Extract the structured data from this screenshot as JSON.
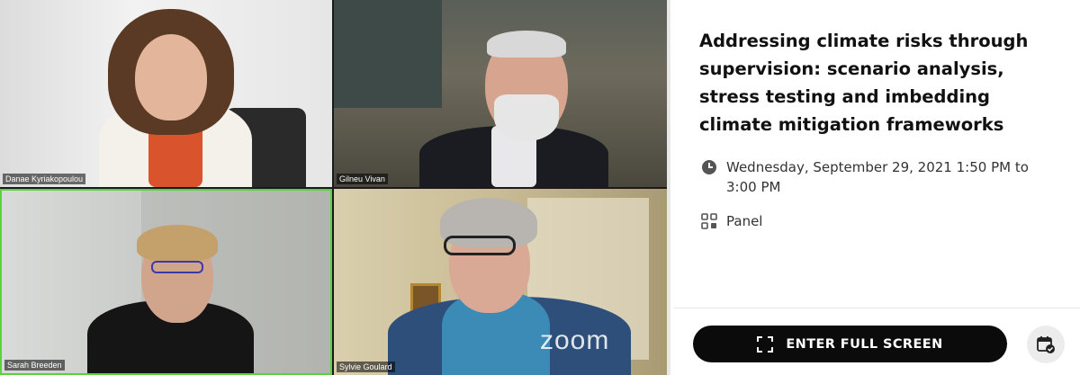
{
  "participants": [
    {
      "name": "Danae Kyriakopoulou"
    },
    {
      "name": "Gilneu Vivan"
    },
    {
      "name": "Sarah Breeden"
    },
    {
      "name": "Sylvie Goulard"
    }
  ],
  "watermark": "zoom",
  "session": {
    "title": "Addressing climate risks through supervision: scenario analysis, stress testing and imbedding climate mitigation frameworks",
    "datetime": "Wednesday, September 29, 2021 1:50 PM to 3:00 PM",
    "type": "Panel",
    "clock_icon": "clock-icon",
    "type_icon": "panel-icon"
  },
  "actions": {
    "fullscreen_label": "ENTER FULL SCREEN",
    "fullscreen_icon": "fullscreen-icon",
    "calendar_icon": "calendar-check-icon"
  },
  "colors": {
    "active_speaker_border": "#5ad23a",
    "button_bg": "#0b0b0b"
  }
}
